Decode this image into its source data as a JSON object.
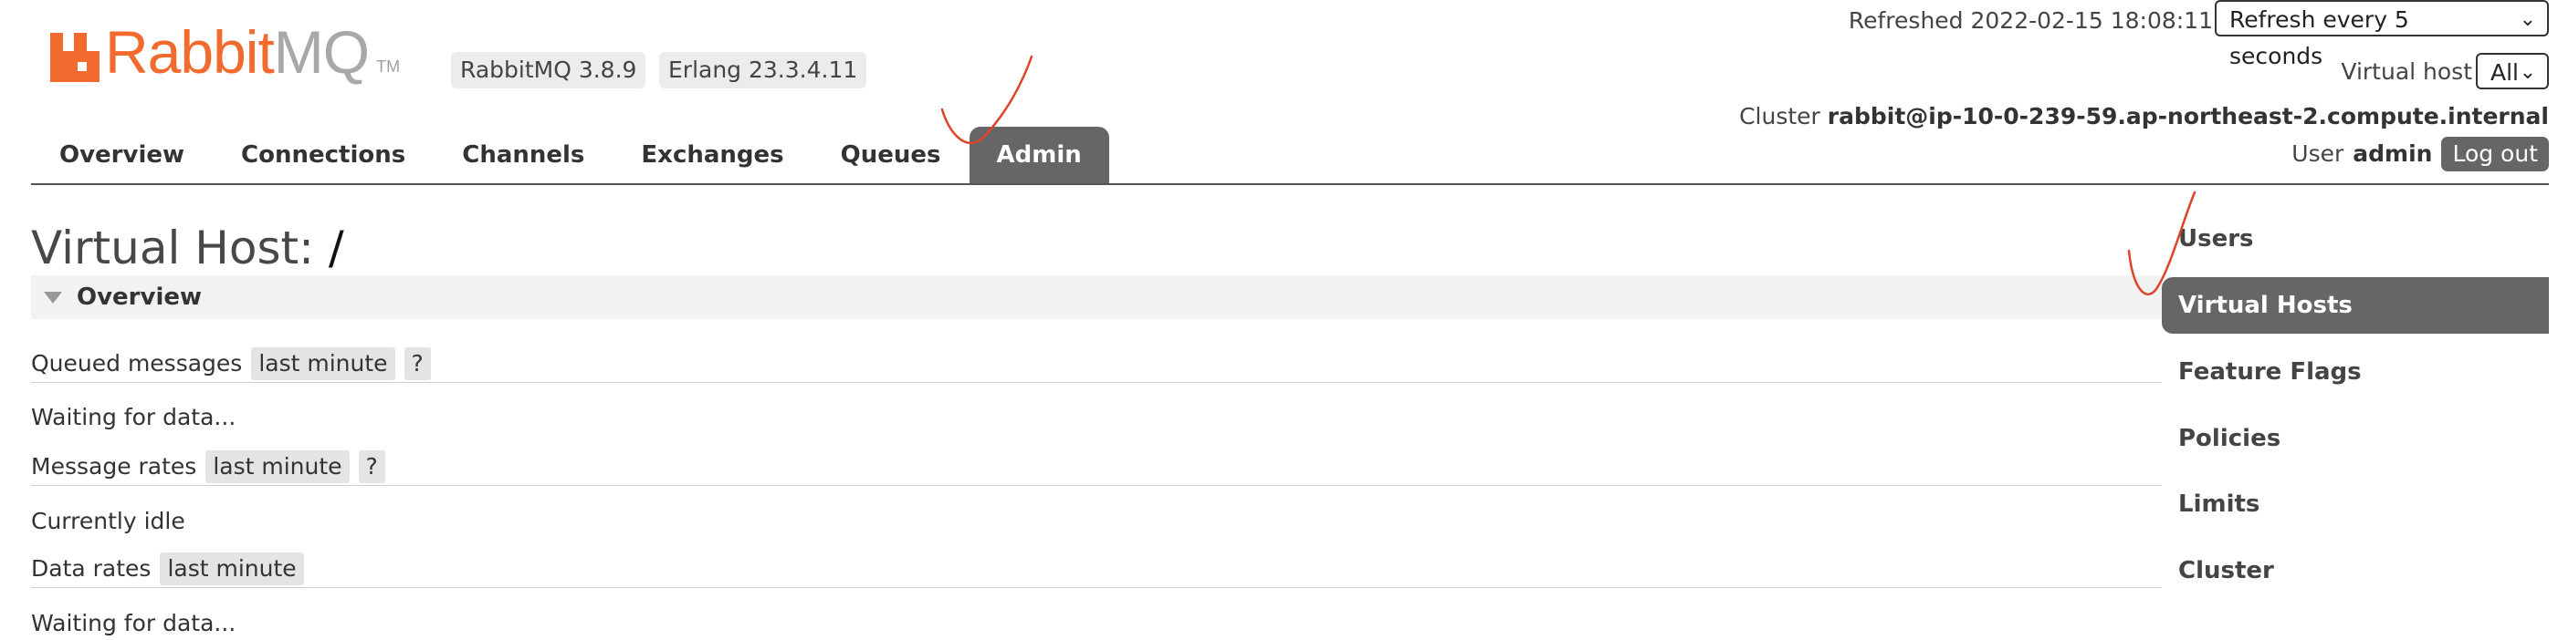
{
  "logo": {
    "rabbit": "Rabbit",
    "mq": "MQ",
    "tm": "TM"
  },
  "versions": {
    "rabbitmq": "RabbitMQ 3.8.9",
    "erlang": "Erlang 23.3.4.11"
  },
  "header": {
    "refreshed": "Refreshed 2022-02-15 18:08:11",
    "refresh_option": "Refresh every 5 seconds",
    "virtual_host_label": "Virtual host",
    "virtual_host_value": "All",
    "cluster_label": "Cluster",
    "cluster_name": "rabbit@ip-10-0-239-59.ap-northeast-2.compute.internal",
    "user_label": "User",
    "user_name": "admin",
    "logout_label": "Log out"
  },
  "nav": {
    "tabs": [
      {
        "label": "Overview"
      },
      {
        "label": "Connections"
      },
      {
        "label": "Channels"
      },
      {
        "label": "Exchanges"
      },
      {
        "label": "Queues"
      },
      {
        "label": "Admin"
      }
    ],
    "active": "Admin"
  },
  "page": {
    "title_prefix": "Virtual Host:",
    "title_value": "/",
    "section": "Overview",
    "queued_messages": {
      "label": "Queued messages",
      "range": "last minute",
      "help": "?"
    },
    "queued_status": "Waiting for data...",
    "message_rates": {
      "label": "Message rates",
      "range": "last minute",
      "help": "?"
    },
    "message_status": "Currently idle",
    "data_rates": {
      "label": "Data rates",
      "range": "last minute"
    },
    "data_status": "Waiting for data..."
  },
  "sidebar": {
    "items": [
      {
        "label": "Users"
      },
      {
        "label": "Virtual Hosts"
      },
      {
        "label": "Feature Flags"
      },
      {
        "label": "Policies"
      },
      {
        "label": "Limits"
      },
      {
        "label": "Cluster"
      }
    ],
    "active": "Virtual Hosts"
  },
  "colors": {
    "brand_orange": "#f26a2e",
    "active_tab": "#666666",
    "annotation": "#e0432b"
  }
}
